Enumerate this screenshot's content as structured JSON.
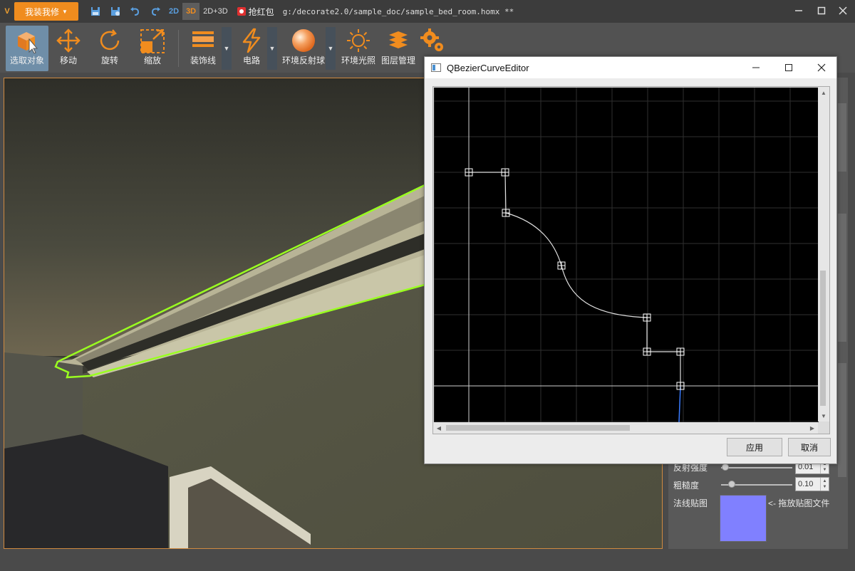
{
  "app": {
    "logo": "V",
    "brand_button": "我装我修",
    "modes": [
      "2D",
      "3D",
      "2D+3D"
    ],
    "red_packet": "抢红包",
    "file_path": "g:/decorate2.0/sample_doc/sample_bed_room.homx **"
  },
  "toolbar": {
    "tools": [
      {
        "label": "选取对象",
        "icon": "select-cube-icon"
      },
      {
        "label": "移动",
        "icon": "move-arrows-icon"
      },
      {
        "label": "旋转",
        "icon": "rotate-icon"
      },
      {
        "label": "缩放",
        "icon": "scale-icon"
      },
      {
        "label": "装饰线",
        "icon": "molding-icon"
      },
      {
        "label": "电路",
        "icon": "lightning-icon"
      },
      {
        "label": "环境反射球",
        "icon": "sphere-icon"
      },
      {
        "label": "环境光照",
        "icon": "sun-icon"
      },
      {
        "label": "图层管理",
        "icon": "layers-icon"
      },
      {
        "label": "",
        "icon": "settings-gears-icon"
      }
    ]
  },
  "dialog": {
    "title": "QBezierCurveEditor",
    "apply_label": "应用",
    "cancel_label": "取消"
  },
  "properties": {
    "reflect_label": "反射强度",
    "reflect_value": "0.01",
    "reflect_level": 0.05,
    "roughness_label": "粗糙度",
    "roughness_value": "0.10",
    "roughness_level": 0.15,
    "normal_map_label": "法线贴图",
    "drag_hint": "<- 拖放贴图文件",
    "normal_map_color": "#8080ff"
  },
  "colors": {
    "accent": "#f08c1e",
    "selection_outline": "#9aff20",
    "mode_blue": "#5a9fe0"
  }
}
